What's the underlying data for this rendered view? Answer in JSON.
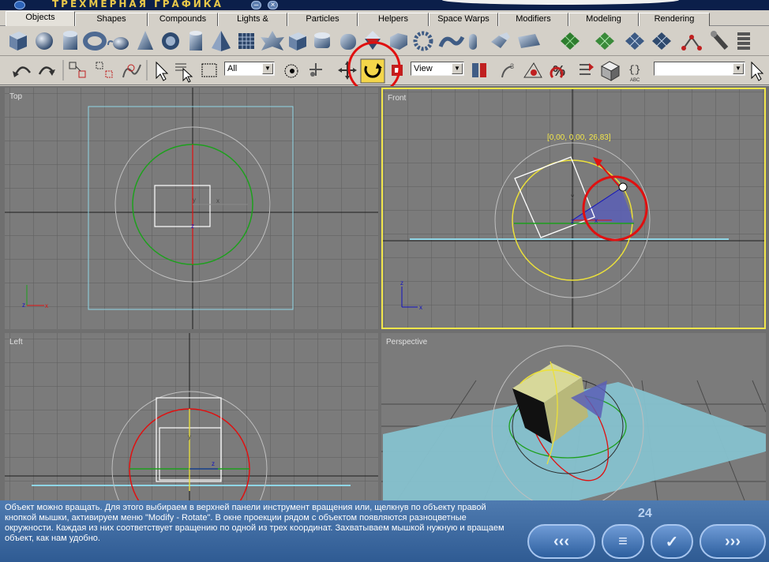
{
  "window": {
    "title": "ТРЕХМЕРНАЯ ГРАФИКА",
    "minimize": "–",
    "close": "×"
  },
  "tabs": [
    {
      "label": "Objects",
      "active": true
    },
    {
      "label": "Shapes"
    },
    {
      "label": "Compounds"
    },
    {
      "label": "Lights & Cameras"
    },
    {
      "label": "Particles"
    },
    {
      "label": "Helpers"
    },
    {
      "label": "Space Warps"
    },
    {
      "label": "Modifiers"
    },
    {
      "label": "Modeling"
    },
    {
      "label": "Rendering"
    }
  ],
  "main_toolbar": {
    "icons": [
      "box-icon",
      "sphere-icon",
      "cylinder-icon",
      "torus-icon",
      "teapot-icon",
      "cone-icon",
      "geosphere-icon",
      "tube-icon",
      "pyramid-icon",
      "plane-grid-icon",
      "hedra-icon",
      "chamfer-box-icon",
      "oil-tank-icon",
      "capsule-icon",
      "spindle-icon",
      "gengon-icon",
      "ring-wave-icon",
      "hose-icon",
      "torus-knot-icon",
      "prism-icon",
      "l-ext-icon",
      "patch-grid-icon",
      "tri-patch-icon",
      "nurbs-surface-icon",
      "nurbs-cv-icon",
      "nurbs-curve-icon",
      "tape-icon",
      "spring-icon"
    ]
  },
  "sub_toolbar": {
    "selection_filter": "All",
    "reference_coord": "View",
    "named_selection": "",
    "snap_label": "3",
    "percent_label": "%"
  },
  "viewports": {
    "top": {
      "label": "Top"
    },
    "front": {
      "label": "Front",
      "rotation_readout": "[0,00, 0,00, 26,83]"
    },
    "left": {
      "label": "Left"
    },
    "perspective": {
      "label": "Perspective"
    }
  },
  "axis_labels": {
    "x": "x",
    "y": "y",
    "z": "z"
  },
  "info": {
    "text": "Объект можно вращать. Для этого выбираем в верхней панели инструмент вращения или, щелкнув по объекту правой кнопкой мышки, активируем меню \"Modify - Rotate\". В окне проекции рядом с объектом появляются разноцветные окружности. Каждая из них соответствует вращению по одной из трех координат. Захватываем мышкой нужную и вращаем объект, как нам удобно.",
    "page_number": "24"
  },
  "nav": {
    "first": "‹‹‹",
    "menu": "≡",
    "check": "✓",
    "next": "›››"
  },
  "colors": {
    "viewport_bg": "#7b7b7b",
    "active_border": "#f2e64a",
    "highlight_circle": "#e01010",
    "info_text": "#ffffff",
    "bounding_box": "#8fd6e6"
  }
}
